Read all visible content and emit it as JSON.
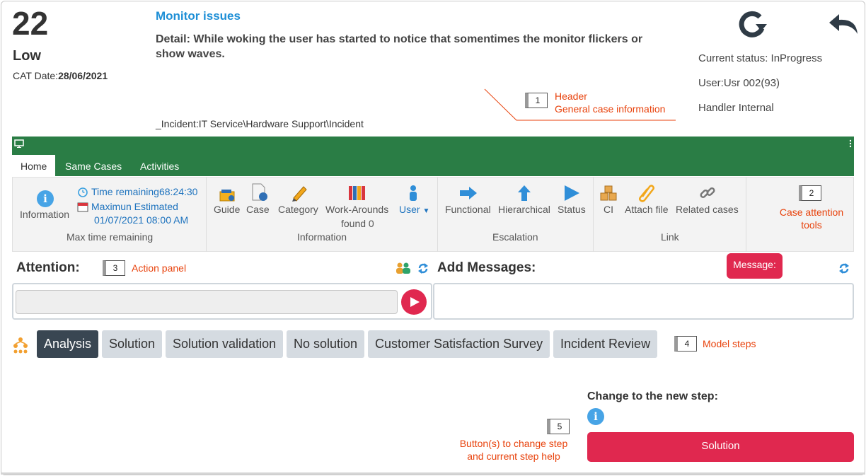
{
  "case": {
    "number": "22",
    "priority": "Low",
    "cat_date_label": "CAT Date:",
    "cat_date_value": "28/06/2021",
    "title": "Monitor issues",
    "detail": "Detail: While woking the user has started to notice that somentimes the monitor flickers or show waves.",
    "incident_path": "_Incident:IT Service\\Hardware Support\\Incident",
    "status": "Current status: InProgress",
    "user": "User:Usr 002(93)",
    "handler": "Handler Internal"
  },
  "callouts": {
    "c1": {
      "num": "1",
      "line1": "Header",
      "line2": "General case information"
    },
    "c2": {
      "num": "2",
      "line1": "Case attention",
      "line2": "tools"
    },
    "c3": {
      "num": "3",
      "text": "Action panel"
    },
    "c4": {
      "num": "4",
      "text": "Model steps"
    },
    "c5": {
      "num": "5",
      "line1": "Button(s) to change step",
      "line2": "and current step help"
    }
  },
  "tabs": [
    "Home",
    "Same Cases",
    "Activities"
  ],
  "ribbon": {
    "information_label": "Information",
    "time_remaining": "Time remaining68:24:30",
    "maximun_estimated": "Maximun Estimated",
    "estimated_date": "01/07/2021 08:00 AM",
    "group_max_time": "Max time remaining",
    "guide": "Guide",
    "case": "Case",
    "category": "Category",
    "workarounds": "Work-Arounds",
    "workarounds_found": "found 0",
    "user": "User",
    "group_information": "Information",
    "functional": "Functional",
    "hierarchical": "Hierarchical",
    "status": "Status",
    "group_escalation": "Escalation",
    "ci": "CI",
    "attach_file": "Attach file",
    "related_cases": "Related cases",
    "group_link": "Link"
  },
  "attention": {
    "label": "Attention:",
    "messages_label": "Add Messages:",
    "message_pill": "Message:"
  },
  "steps": [
    "Analysis",
    "Solution",
    "Solution validation",
    "No solution",
    "Customer Satisfaction Survey",
    "Incident Review"
  ],
  "change_step": {
    "label": "Change to the new step:",
    "button": "Solution"
  },
  "colors": {
    "green": "#2a7d45",
    "accent": "#e0284f",
    "blue": "#1e8fd6",
    "callout": "#e8420c"
  }
}
